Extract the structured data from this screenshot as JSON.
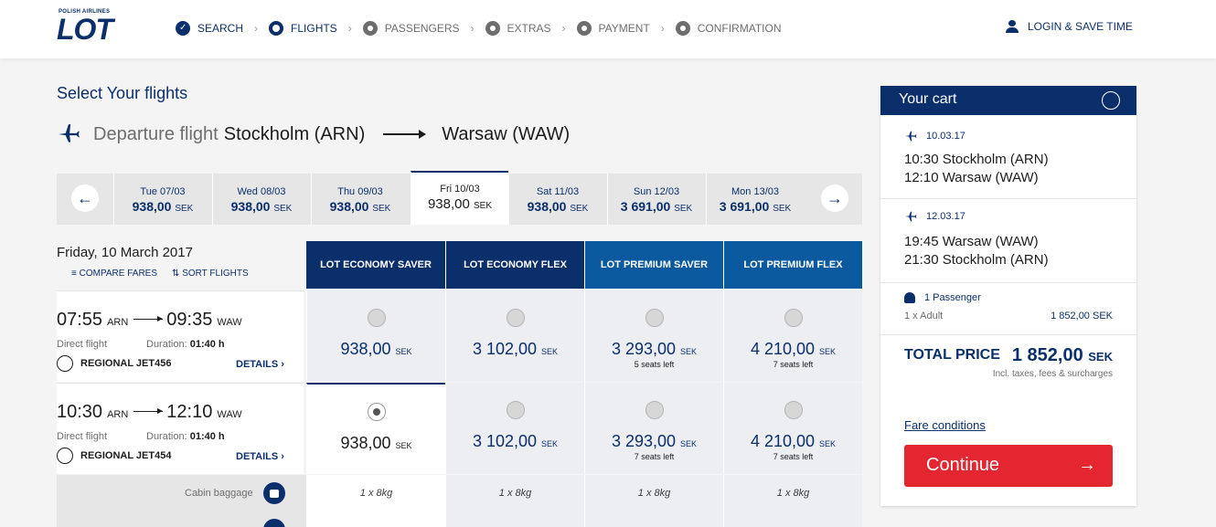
{
  "header": {
    "logo_tag": "POLISH AIRLINES",
    "logo_text": "LOT",
    "steps": [
      {
        "label": "SEARCH",
        "state": "done"
      },
      {
        "label": "FLIGHTS",
        "state": "active"
      },
      {
        "label": "PASSENGERS",
        "state": "todo"
      },
      {
        "label": "EXTRAS",
        "state": "todo"
      },
      {
        "label": "PAYMENT",
        "state": "todo"
      },
      {
        "label": "CONFIRMATION",
        "state": "todo"
      }
    ],
    "login": "LOGIN & SAVE TIME"
  },
  "title": "Select Your flights",
  "route": {
    "label": "Departure flight",
    "from": "Stockholm (ARN)",
    "to": "Warsaw (WAW)"
  },
  "dates": [
    {
      "day": "Tue 07/03",
      "price": "938,00",
      "cur": "SEK"
    },
    {
      "day": "Wed 08/03",
      "price": "938,00",
      "cur": "SEK"
    },
    {
      "day": "Thu 09/03",
      "price": "938,00",
      "cur": "SEK"
    },
    {
      "day": "Fri 10/03",
      "price": "938,00",
      "cur": "SEK"
    },
    {
      "day": "Sat 11/03",
      "price": "938,00",
      "cur": "SEK"
    },
    {
      "day": "Sun 12/03",
      "price": "3 691,00",
      "cur": "SEK"
    },
    {
      "day": "Mon 13/03",
      "price": "3 691,00",
      "cur": "SEK"
    }
  ],
  "date_heading": "Friday, 10 March 2017",
  "tools": {
    "compare": "COMPARE FARES",
    "sort": "SORT FLIGHTS"
  },
  "fare_columns": [
    "LOT ECONOMY SAVER",
    "LOT ECONOMY FLEX",
    "LOT PREMIUM SAVER",
    "LOT PREMIUM FLEX"
  ],
  "fare_colors": [
    "#0b2f6b",
    "#0b2f6b",
    "#0b5aa0",
    "#0b5aa0"
  ],
  "flights": [
    {
      "dep": "07:55",
      "dep_code": "ARN",
      "arr": "09:35",
      "arr_code": "WAW",
      "type": "Direct flight",
      "duration_label": "Duration:",
      "duration": "01:40 h",
      "aircraft": "REGIONAL JET456",
      "details": "DETAILS ›",
      "fares": [
        {
          "price": "938,00",
          "cur": "SEK",
          "seats": ""
        },
        {
          "price": "3 102,00",
          "cur": "SEK",
          "seats": ""
        },
        {
          "price": "3 293,00",
          "cur": "SEK",
          "seats": "5 seats left"
        },
        {
          "price": "4 210,00",
          "cur": "SEK",
          "seats": "7 seats left"
        }
      ]
    },
    {
      "dep": "10:30",
      "dep_code": "ARN",
      "arr": "12:10",
      "arr_code": "WAW",
      "type": "Direct flight",
      "duration_label": "Duration:",
      "duration": "01:40 h",
      "aircraft": "REGIONAL JET454",
      "details": "DETAILS ›",
      "fares": [
        {
          "price": "938,00",
          "cur": "SEK",
          "seats": ""
        },
        {
          "price": "3 102,00",
          "cur": "SEK",
          "seats": ""
        },
        {
          "price": "3 293,00",
          "cur": "SEK",
          "seats": "7 seats left"
        },
        {
          "price": "4 210,00",
          "cur": "SEK",
          "seats": "7 seats left"
        }
      ]
    }
  ],
  "baggage": {
    "label": "Cabin baggage",
    "values": [
      "1 x 8kg",
      "1 x 8kg",
      "1 x 8kg",
      "1 x 8kg"
    ]
  },
  "cart": {
    "title": "Your cart",
    "legs": [
      {
        "date": "10.03.17",
        "line1": "10:30 Stockholm (ARN)",
        "line2": "12:10 Warsaw (WAW)"
      },
      {
        "date": "12.03.17",
        "line1": "19:45 Warsaw (WAW)",
        "line2": "21:30 Stockholm (ARN)"
      }
    ],
    "passengers": "1 Passenger",
    "pax_line": "1 x Adult",
    "pax_price": "1 852,00 SEK",
    "total_label": "TOTAL PRICE",
    "total_value": "1 852,00",
    "total_cur": "SEK",
    "total_note": "Incl. taxes, fees & surcharges",
    "fare_conditions": "Fare conditions",
    "continue": "Continue"
  }
}
